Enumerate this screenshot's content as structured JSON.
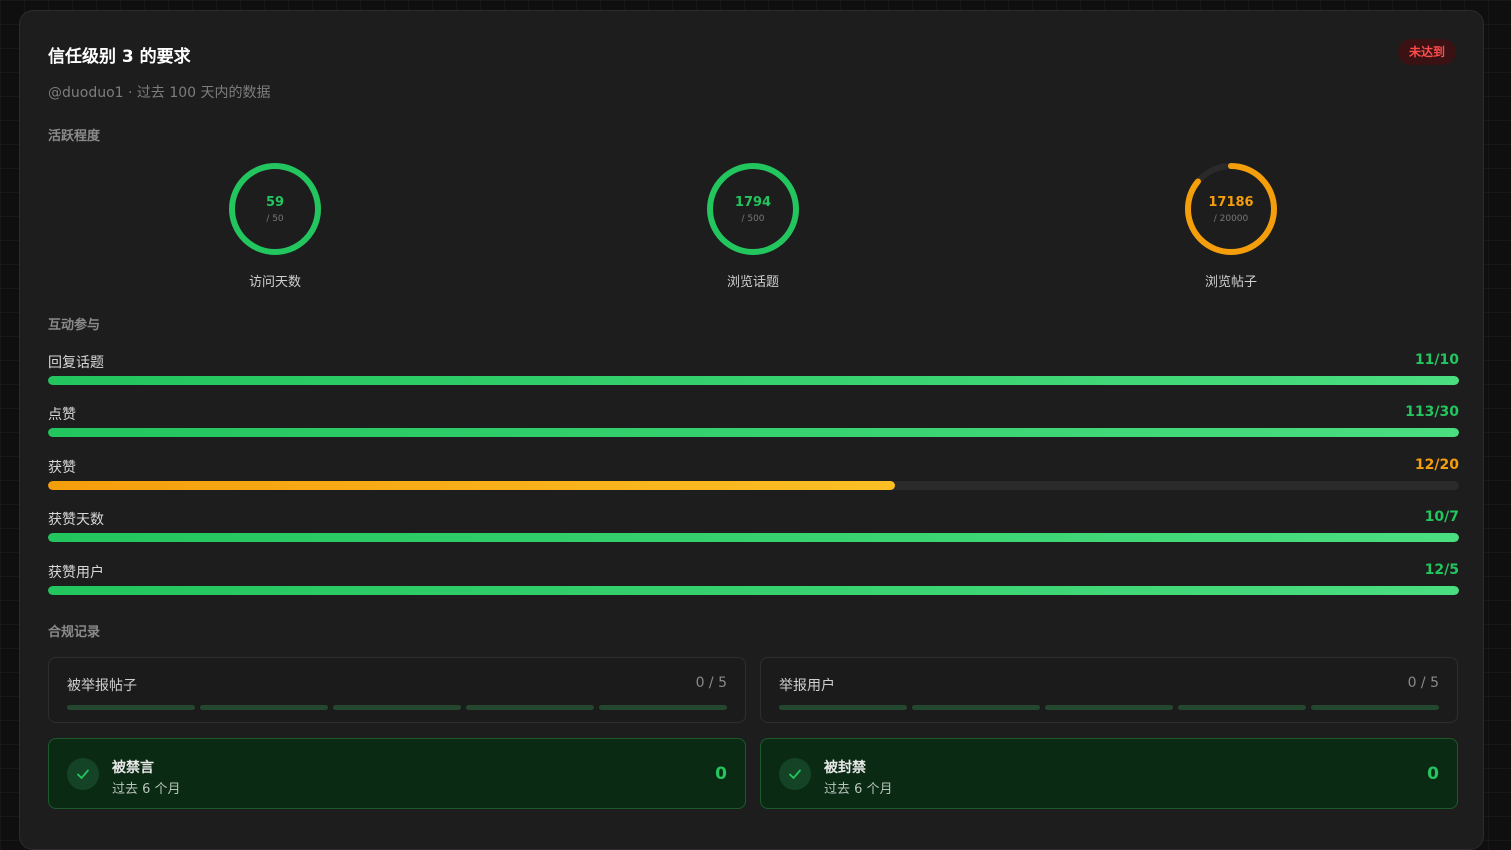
{
  "header": {
    "title": "信任级别 3 的要求",
    "status_badge": "未达到",
    "subtitle": "@duoduo1 · 过去 100 天内的数据"
  },
  "sections": {
    "activity": "活跃程度",
    "engagement": "互动参与",
    "compliance": "合规记录"
  },
  "activity": [
    {
      "label": "访问天数",
      "value": "59",
      "max": "/ 50",
      "progress": 1.0,
      "color": "#22c55e"
    },
    {
      "label": "浏览话题",
      "value": "1794",
      "max": "/ 500",
      "progress": 1.0,
      "color": "#22c55e"
    },
    {
      "label": "浏览帖子",
      "value": "17186",
      "max": "/ 20000",
      "progress": 0.8593,
      "color": "#f59e0b"
    }
  ],
  "engagement": [
    {
      "label": "回复话题",
      "value": "11/10",
      "progress": 1.0,
      "color": "#22c55e"
    },
    {
      "label": "点赞",
      "value": "113/30",
      "progress": 1.0,
      "color": "#22c55e"
    },
    {
      "label": "获赞",
      "value": "12/20",
      "progress": 0.6,
      "color": "#f59e0b"
    },
    {
      "label": "获赞天数",
      "value": "10/7",
      "progress": 1.0,
      "color": "#22c55e"
    },
    {
      "label": "获赞用户",
      "value": "12/5",
      "progress": 1.0,
      "color": "#22c55e"
    }
  ],
  "compliance": [
    {
      "label": "被举报帖子",
      "value": "0 / 5"
    },
    {
      "label": "举报用户",
      "value": "0 / 5"
    }
  ],
  "penalties": [
    {
      "title": "被禁言",
      "subtitle": "过去 6 个月",
      "value": "0",
      "icon": "check-icon"
    },
    {
      "title": "被封禁",
      "subtitle": "过去 6 个月",
      "value": "0",
      "icon": "check-icon"
    }
  ]
}
